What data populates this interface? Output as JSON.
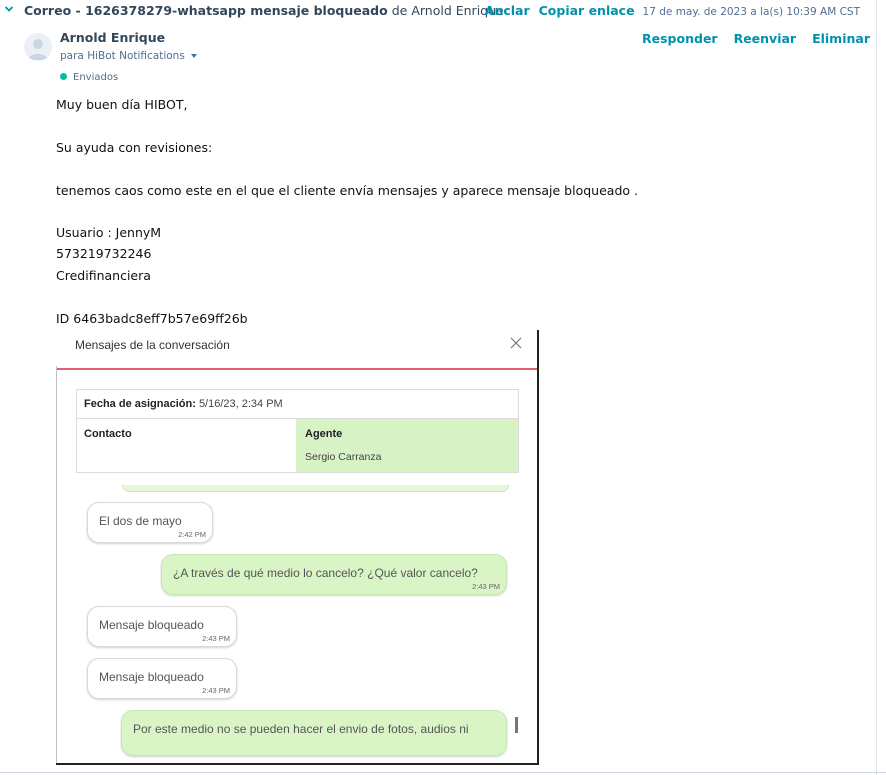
{
  "header": {
    "subject_prefix": "Correo - ",
    "subject": "1626378279-whatsapp mensaje bloqueado",
    "from_word": "de",
    "from_name": "Arnold Enrique",
    "pin_label": "Anclar",
    "copy_link_label": "Copiar enlace",
    "date": "17 de may. de 2023 a la(s) 10:39 AM CST"
  },
  "message": {
    "sender": "Arnold Enrique",
    "recipient": "para HiBot Notifications",
    "status": "Enviados",
    "reply_label": "Responder",
    "forward_label": "Reenviar",
    "delete_label": "Eliminar",
    "body": {
      "greeting": "Muy buen día HIBOT,",
      "line1": "Su ayuda con revisiones:",
      "line2": "tenemos caos como este en el que el cliente envía mensajes y aparece mensaje bloqueado .",
      "user": "Usuario : JennyM",
      "phone": "573219732246",
      "company": "Credifinanciera",
      "id": "ID 6463badc8eff7b57e69ff26b"
    }
  },
  "embedded": {
    "title": "Mensajes de la conversación",
    "assign_label": "Fecha de asignación:",
    "assign_value": "5/16/23, 2:34 PM",
    "contact_label": "Contacto",
    "agent_label": "Agente",
    "agent_name": "Sergio Carranza",
    "messages": [
      {
        "text": "El dos de mayo",
        "time": "2:42 PM"
      },
      {
        "text": "¿A través de qué medio lo cancelo? ¿Qué valor cancelo?",
        "time": "2:43 PM"
      },
      {
        "text": "Mensaje bloqueado",
        "time": "2:43 PM"
      },
      {
        "text": "Mensaje bloqueado",
        "time": "2:43 PM"
      },
      {
        "text": "Por este medio no se pueden hacer el envio de fotos, audios ni",
        "time": ""
      }
    ]
  },
  "colors": {
    "link": "#0091ae",
    "status_dot": "#00bda5",
    "agent_bg": "#d7f2c4",
    "modal_divider": "#e0606d"
  },
  "icons": [
    "chevron-down-icon",
    "avatar-icon",
    "caret-down-icon",
    "close-icon"
  ]
}
